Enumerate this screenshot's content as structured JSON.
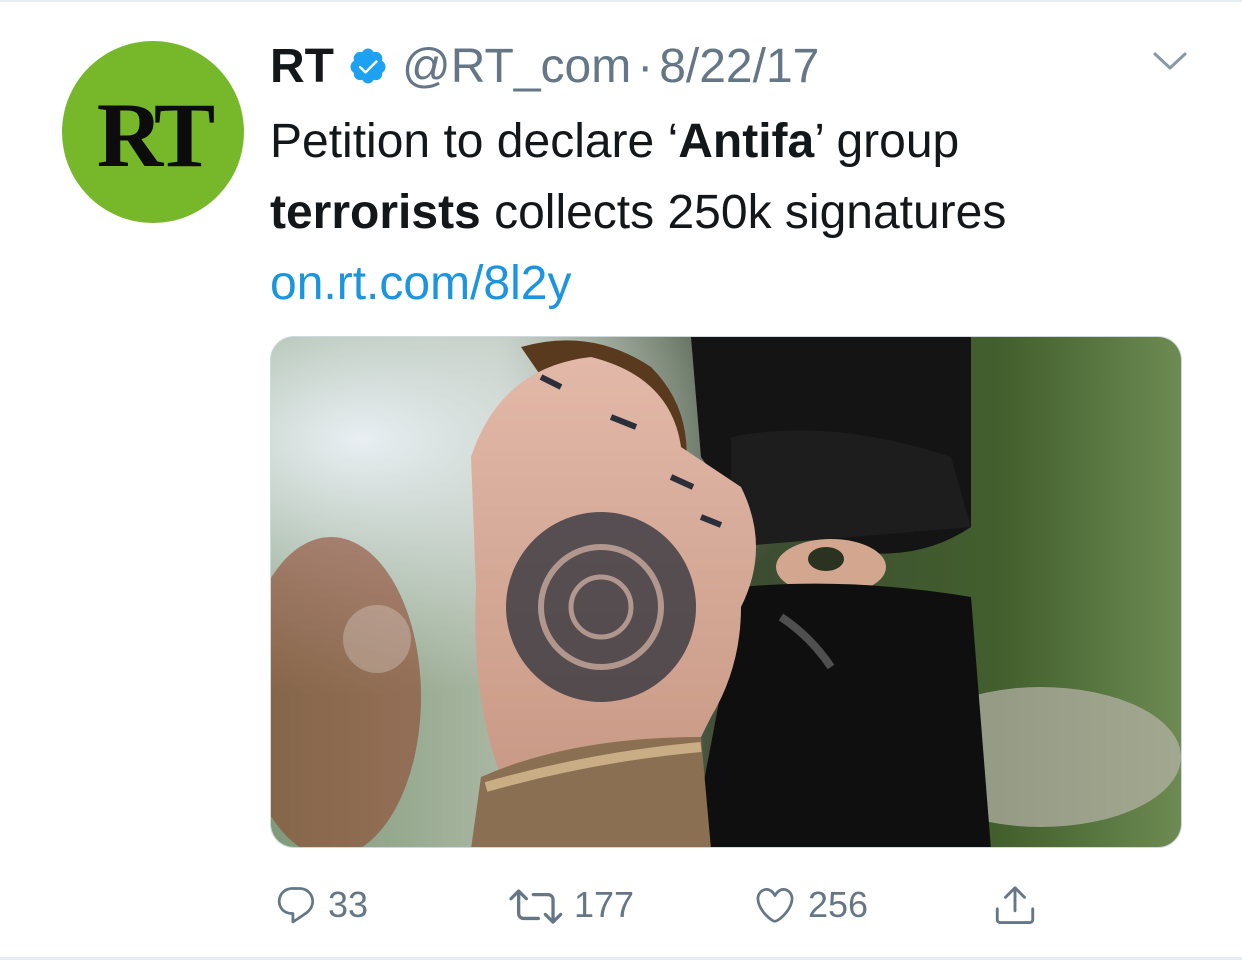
{
  "tweet": {
    "author_name": "RT",
    "handle": "@RT_com",
    "separator": "·",
    "date": "8/22/17",
    "avatar_text": "RT",
    "text_part1": "Petition to declare ‘",
    "text_bold1": "Antifa",
    "text_part2": "’ group",
    "text_bold2": "terrorists",
    "text_part3": " collects 250k signatures",
    "link": "on.rt.com/8l2y"
  },
  "actions": {
    "reply_count": "33",
    "retweet_count": "177",
    "like_count": "256"
  },
  "icons": {
    "verified": "verified-badge-icon",
    "more": "chevron-down-icon",
    "reply": "reply-icon",
    "retweet": "retweet-icon",
    "like": "heart-icon",
    "share": "share-icon"
  },
  "colors": {
    "avatar_bg": "#77b82a",
    "verified": "#1da1f2",
    "link": "#1b95e0",
    "muted": "#657786"
  }
}
